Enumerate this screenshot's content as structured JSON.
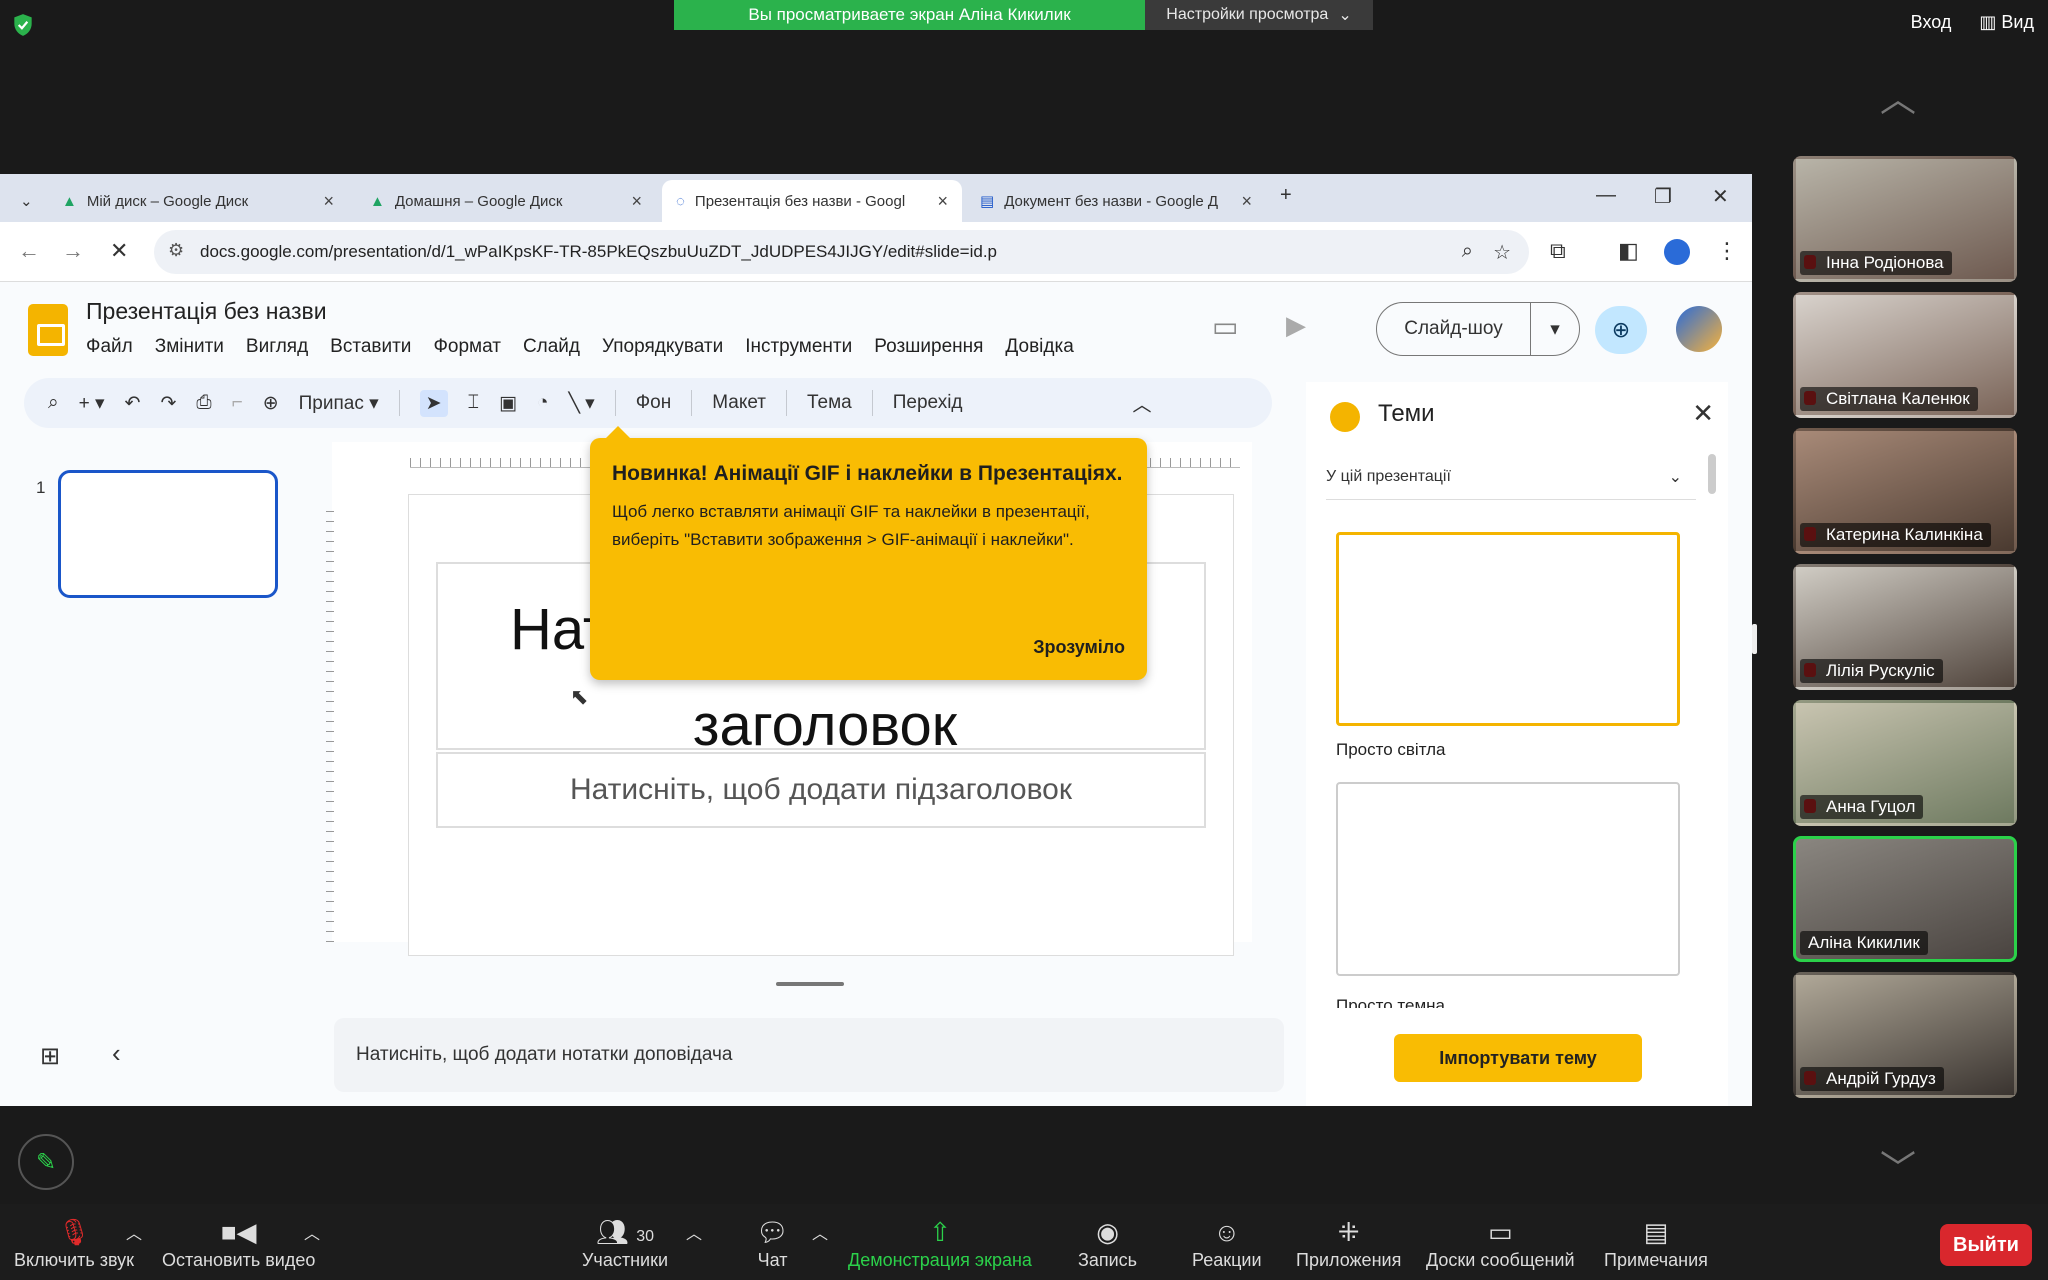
{
  "zoom": {
    "share_banner": "Вы просматриваете экран Аліна Кикилик",
    "view_settings": "Настройки просмотра",
    "enter_label": "Вход",
    "view_label": "Вид",
    "accent_green": "#2bb24c",
    "participants": [
      {
        "name": "Інна Родіонова",
        "muted": true,
        "speaking": false
      },
      {
        "name": "Світлана Каленюк",
        "muted": true,
        "speaking": false
      },
      {
        "name": "Катерина Калинкіна",
        "muted": true,
        "speaking": false
      },
      {
        "name": "Лілія Рускуліс",
        "muted": true,
        "speaking": false
      },
      {
        "name": "Анна Гуцол",
        "muted": true,
        "speaking": false
      },
      {
        "name": "Аліна Кикилик",
        "muted": false,
        "speaking": true
      },
      {
        "name": "Андрій Гурдуз",
        "muted": true,
        "speaking": false
      }
    ],
    "bottom": {
      "unmute": "Включить звук",
      "stop_video": "Остановить видео",
      "participants": "Участники",
      "participants_count": "30",
      "chat": "Чат",
      "share_screen": "Демонстрация экрана",
      "record": "Запись",
      "reactions": "Реакции",
      "apps": "Приложения",
      "whiteboards": "Доски сообщений",
      "notes": "Примечания",
      "leave": "Выйти"
    }
  },
  "browser": {
    "tabs": [
      {
        "label": "Мій диск – Google Диск"
      },
      {
        "label": "Домашня – Google Диск"
      },
      {
        "label": "Презентація без назви - Googl"
      },
      {
        "label": "Документ без назви - Google Д"
      }
    ],
    "url": "docs.google.com/presentation/d/1_wPaIKpsKF-TR-85PkEQszbuUuZDT_JdUDPES4JIJGY/edit#slide=id.p"
  },
  "slides": {
    "doc_title": "Презентація без назви",
    "menus": [
      "Файл",
      "Змінити",
      "Вигляд",
      "Вставити",
      "Формат",
      "Слайд",
      "Упорядкувати",
      "Інструменти",
      "Розширення",
      "Довідка"
    ],
    "toolbar": {
      "zoom_label": "Припас",
      "bg": "Фон",
      "layout": "Макет",
      "theme": "Тема",
      "transition": "Перехід"
    },
    "slideshow_label": "Слайд-шоу",
    "slide_number": "1",
    "title_placeholder": "Натисніть, щоб додати заголовок",
    "title_visible_left": "Нат",
    "title_visible_line2": "заголовок",
    "subtitle_placeholder": "Натисніть, щоб додати підзаголовок",
    "notes_placeholder": "Натисніть, щоб додати нотатки доповідача",
    "tooltip": {
      "heading": "Новинка! Анімації GIF і наклейки в Презентаціях.",
      "body": "Щоб легко вставляти анімації GIF та наклейки в презентації, виберіть \"Вставити зображення > GIF-анімації і наклейки\".",
      "ok": "Зрозуміло",
      "color": "#f9bc03"
    },
    "themes": {
      "title": "Теми",
      "selector": "У цій презентації",
      "theme1": "Просто світла",
      "theme2": "Просто темна",
      "import": "Імпортувати тему"
    }
  }
}
